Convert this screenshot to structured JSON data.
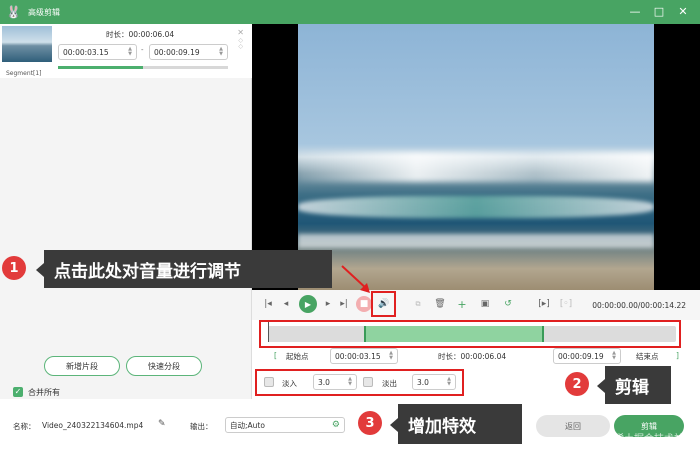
{
  "window": {
    "title": "高级剪辑"
  },
  "segment": {
    "label": "Segment[1]",
    "duration_label": "时长：",
    "duration_value": "00:00:06.04",
    "start_time": "00:00:03.15",
    "end_time": "00:00:09.19",
    "separator": "-"
  },
  "left_buttons": {
    "new_segment": "新增片段",
    "quick_split": "快速分段"
  },
  "merge_all": {
    "label": "合并所有",
    "checked": true
  },
  "player": {
    "time_display": "00:00:00.00/00:00:14.22"
  },
  "trim": {
    "start_label": "起始点",
    "start_value": "00:00:03.15",
    "duration_label": "时长：",
    "duration_value": "00:00:06.04",
    "end_value": "00:00:09.19",
    "end_label": "结束点"
  },
  "effects": {
    "fade_in_label": "淡入",
    "fade_in_value": "3.0",
    "fade_out_label": "淡出",
    "fade_out_value": "3.0"
  },
  "footer": {
    "name_label": "名称：",
    "name_value": "Video_240322134604.mp4",
    "output_label": "输出：",
    "output_value": "自动;Auto",
    "back_button": "返回",
    "cut_button": "剪辑"
  },
  "callouts": [
    {
      "number": "1",
      "text": "点击此处对音量进行调节"
    },
    {
      "number": "2",
      "text": "剪辑"
    },
    {
      "number": "3",
      "text": "增加特效"
    }
  ],
  "watermark": "@稀土掘金技术社区",
  "colors": {
    "accent": "#48a463",
    "highlight": "#e02020",
    "callout_bg": "#3a3a3a"
  }
}
